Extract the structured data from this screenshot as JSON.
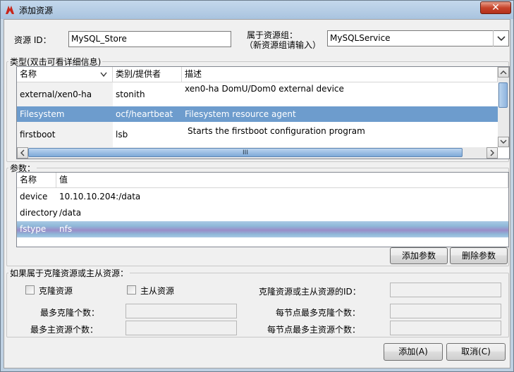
{
  "window": {
    "title": "添加资源"
  },
  "resource_id": {
    "label": "资源 ID：",
    "value": "MySQL_Store"
  },
  "resource_group": {
    "label_line1": "属于资源组：",
    "label_line2": "（新资源组请输入）",
    "value": "MySQLService"
  },
  "types": {
    "group_title": "类型(双击可看详细信息)",
    "columns": [
      "名称",
      "类别/提供者",
      "描述"
    ],
    "rows": [
      {
        "name": "external/xen0-ha",
        "provider": "stonith",
        "description": "xen0-ha DomU/Dom0 external device"
      },
      {
        "name": "Filesystem",
        "provider": "ocf/heartbeat",
        "description": "Filesystem resource agent"
      },
      {
        "name": "firstboot",
        "provider": "lsb",
        "description": "Starts the firstboot configuration program"
      }
    ],
    "h_scroll_grip": "III"
  },
  "params": {
    "group_title": "参数：",
    "columns": [
      "名称",
      "值"
    ],
    "rows": [
      {
        "name": "device",
        "value": "10.10.10.204:/data"
      },
      {
        "name": "directory",
        "value": "/data"
      },
      {
        "name": "fstype",
        "value": "nfs"
      }
    ],
    "add_label": "添加参数",
    "delete_label": "删除参数"
  },
  "clone": {
    "group_title": "如果属于克隆资源或主从资源：",
    "clone_checkbox": "克隆资源",
    "master_checkbox": "主从资源",
    "id_label": "克隆资源或主从资源的ID：",
    "max_clones_label": "最多克隆个数：",
    "max_masters_label": "最多主资源个数：",
    "per_node_clones_label": "每节点最多克隆个数：",
    "per_node_masters_label": "每节点最多主资源个数："
  },
  "footer": {
    "add_label": "添加(A)",
    "cancel_label": "取消(C)"
  },
  "colors": {
    "selection": "#6d9ccd",
    "title_bg": "#b4cbe3",
    "close": "#c7442b"
  },
  "icons": {
    "title": "app-logo-icon",
    "close": "close-icon",
    "dropdown": "chevron-down-icon"
  }
}
